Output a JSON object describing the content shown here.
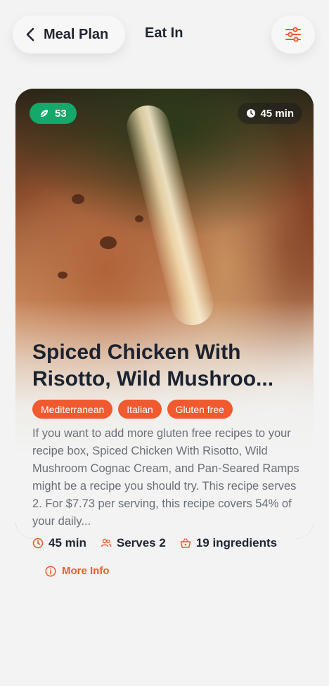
{
  "header": {
    "back_label": "Meal Plan",
    "title": "Eat In",
    "filter_icon": "sliders-icon"
  },
  "recipe": {
    "score": "53",
    "time_badge": "45 min",
    "title": "Spiced Chicken With Risotto, Wild Mushroo...",
    "tags": [
      "Mediterranean",
      "Italian",
      "Gluten free"
    ],
    "description": "If you want to add more gluten free recipes to your recipe box, Spiced Chicken With Risotto, Wild Mushroom Cognac Cream, and Pan-Seared Ramps might be a recipe you should try. This recipe serves 2. For $7.73 per serving, this recipe covers 54% of your daily...",
    "meta": {
      "time": "45 min",
      "serves": "Serves 2",
      "ingredients": "19 ingredients"
    },
    "more_info_label": "More Info"
  },
  "colors": {
    "accent": "#f05a2e",
    "score_green": "#14a86a",
    "background": "#f2f3f2"
  }
}
